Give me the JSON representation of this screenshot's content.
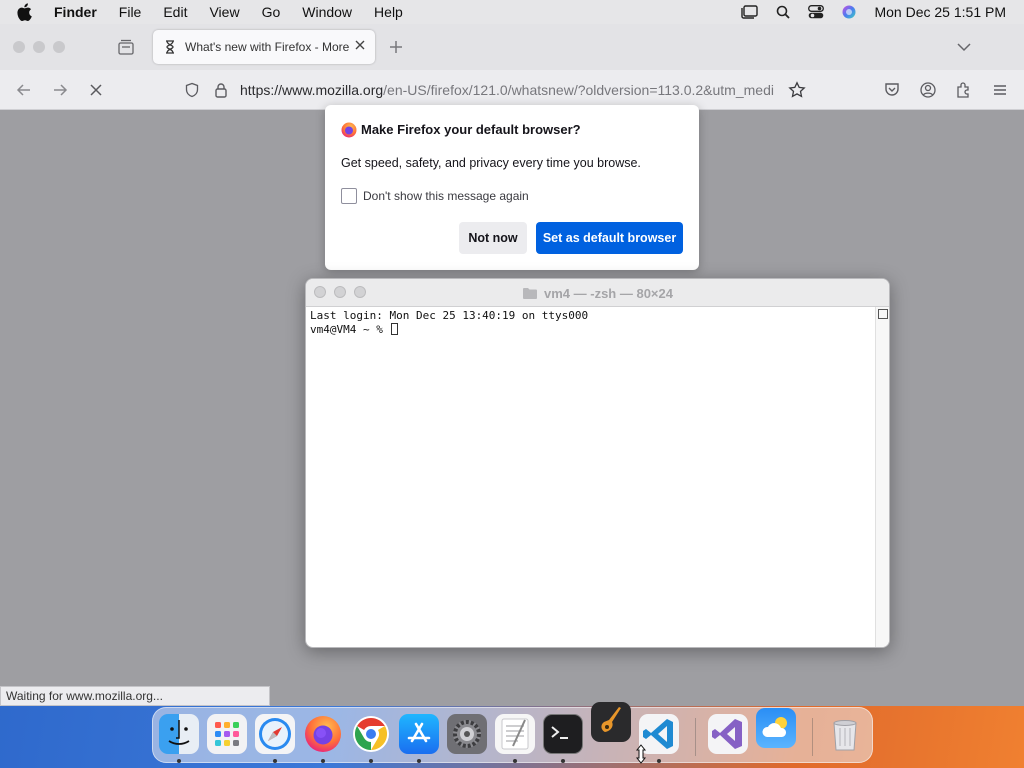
{
  "menubar": {
    "app_name": "Finder",
    "items": [
      "File",
      "Edit",
      "View",
      "Go",
      "Window",
      "Help"
    ],
    "clock": "Mon Dec 25  1:51 PM"
  },
  "firefox": {
    "tab_title": "What's new with Firefox - More",
    "url_domain": "https://www.mozilla.org",
    "url_path": "/en-US/firefox/121.0/whatsnew/?oldversion=113.0.2&utm_medi",
    "status_text": "Waiting for www.mozilla.org..."
  },
  "dialog": {
    "heading": "Make Firefox your default browser?",
    "body": "Get speed, safety, and privacy every time you browse.",
    "checkbox_label": "Don't show this message again",
    "checkbox_checked": false,
    "secondary_button": "Not now",
    "primary_button": "Set as default browser",
    "primary_color": "#0061e0"
  },
  "terminal": {
    "title": "vm4 — -zsh — 80×24",
    "line1": "Last login: Mon Dec 25 13:40:19 on ttys000",
    "prompt": "vm4@VM4 ~ % "
  },
  "dock": {
    "apps": [
      "Finder",
      "Launchpad",
      "Safari",
      "Firefox",
      "Google Chrome",
      "App Store",
      "System Settings",
      "TextEdit",
      "Terminal",
      "GarageBand",
      "Visual Studio Code",
      "Visual Studio",
      "Weather",
      "Trash"
    ]
  }
}
